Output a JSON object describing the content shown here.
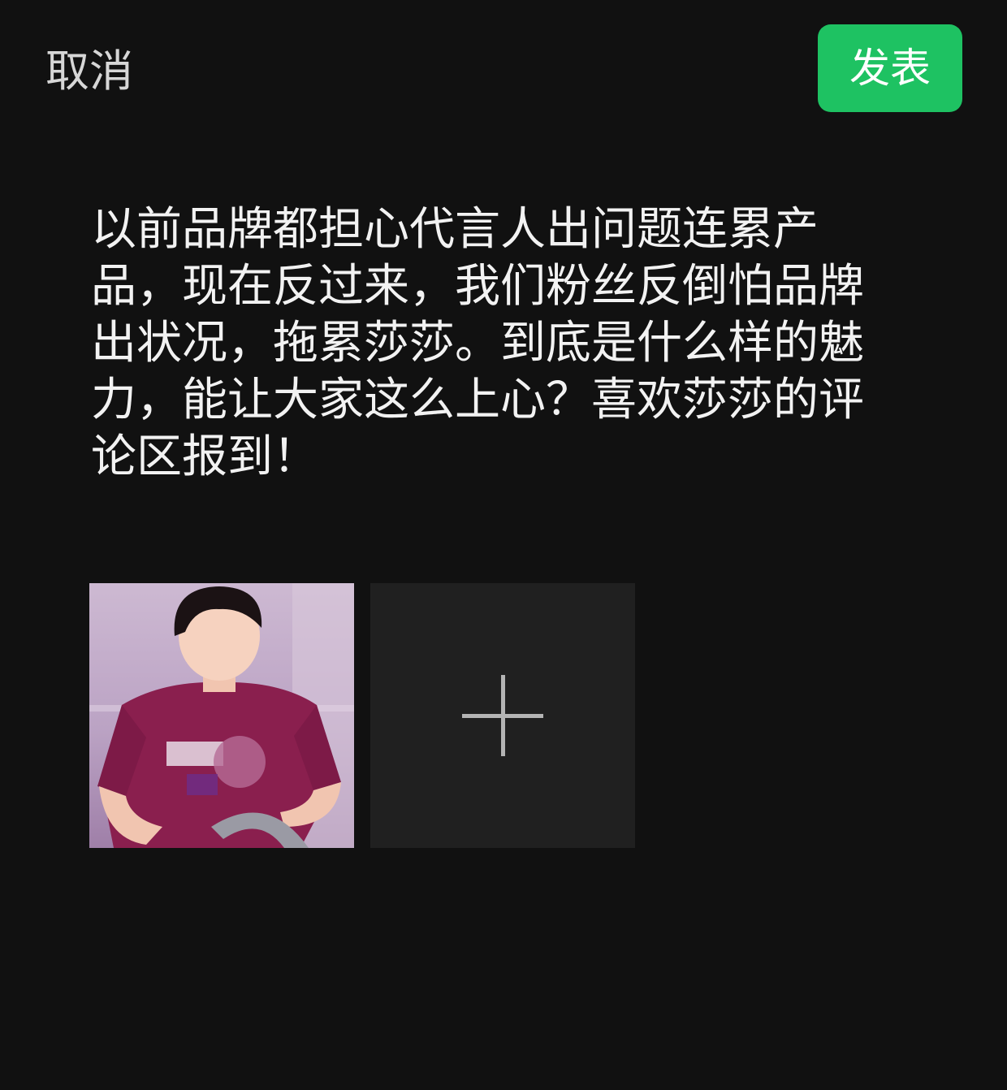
{
  "header": {
    "cancel_label": "取消",
    "publish_label": "发表"
  },
  "post": {
    "text": "以前品牌都担心代言人出问题连累产品，现在反过来，我们粉丝反倒怕品牌出状况，拖累莎莎。到底是什么样的魅力，能让大家这么上心？喜欢莎莎的评论区报到！"
  },
  "colors": {
    "background": "#111111",
    "publish_button": "#1ec262",
    "add_tile": "#202020"
  },
  "icons": {
    "add": "plus-icon"
  }
}
